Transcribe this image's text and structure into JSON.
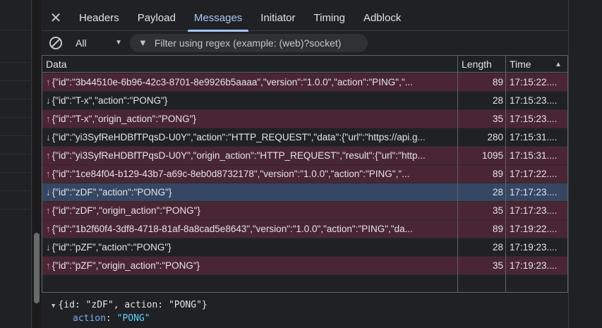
{
  "tabs": [
    {
      "label": "Headers"
    },
    {
      "label": "Payload"
    },
    {
      "label": "Messages",
      "active": true
    },
    {
      "label": "Initiator"
    },
    {
      "label": "Timing"
    },
    {
      "label": "Adblock"
    }
  ],
  "toolbar": {
    "type_filter": "All",
    "filter_placeholder": "Filter using regex (example: (web)?socket)"
  },
  "columns": {
    "data": "Data",
    "length": "Length",
    "time": "Time"
  },
  "messages": [
    {
      "dir": "sent",
      "data": "{\"id\":\"3b44510e-6b96-42c3-8701-8e9926b5aaaa\",\"version\":\"1.0.0\",\"action\":\"PING\",\"...",
      "length": "89",
      "time": "17:15:22...."
    },
    {
      "dir": "recv",
      "data": "{\"id\":\"T-x\",\"action\":\"PONG\"}",
      "length": "28",
      "time": "17:15:23...."
    },
    {
      "dir": "sent",
      "data": "{\"id\":\"T-x\",\"origin_action\":\"PONG\"}",
      "length": "35",
      "time": "17:15:23...."
    },
    {
      "dir": "recv",
      "data": "{\"id\":\"yi3SyfReHDBfTPqsD-U0Y\",\"action\":\"HTTP_REQUEST\",\"data\":{\"url\":\"https://api.g...",
      "length": "280",
      "time": "17:15:31...."
    },
    {
      "dir": "sent",
      "data": "{\"id\":\"yi3SyfReHDBfTPqsD-U0Y\",\"origin_action\":\"HTTP_REQUEST\",\"result\":{\"url\":\"http...",
      "length": "1095",
      "time": "17:15:31...."
    },
    {
      "dir": "sent",
      "data": "{\"id\":\"1ce84f04-b129-43b7-a69c-8eb0d8732178\",\"version\":\"1.0.0\",\"action\":\"PING\",\"...",
      "length": "89",
      "time": "17:17:22...."
    },
    {
      "dir": "recv",
      "data": "{\"id\":\"zDF\",\"action\":\"PONG\"}",
      "length": "28",
      "time": "17:17:23....",
      "selected": true
    },
    {
      "dir": "sent",
      "data": "{\"id\":\"zDF\",\"origin_action\":\"PONG\"}",
      "length": "35",
      "time": "17:17:23...."
    },
    {
      "dir": "sent",
      "data": "{\"id\":\"1b2f60f4-3df8-4718-81af-8a8cad5e8643\",\"version\":\"1.0.0\",\"action\":\"PING\",\"da...",
      "length": "89",
      "time": "17:19:22...."
    },
    {
      "dir": "recv",
      "data": "{\"id\":\"pZF\",\"action\":\"PONG\"}",
      "length": "28",
      "time": "17:19:23...."
    },
    {
      "dir": "sent",
      "data": "{\"id\":\"pZF\",\"origin_action\":\"PONG\"}",
      "length": "35",
      "time": "17:19:23...."
    }
  ],
  "detail": {
    "summary": "{id: \"zDF\", action: \"PONG\"}",
    "key": "action",
    "sep": ": ",
    "value": "\"PONG\""
  },
  "colors": {
    "sent_row": "#4a2635",
    "selected_row": "#354764",
    "accent": "#a8c7fa"
  },
  "icons": {
    "close": "close-icon",
    "block": "block-icon",
    "filter": "filter-icon",
    "sort": "sort-ascending-icon"
  }
}
